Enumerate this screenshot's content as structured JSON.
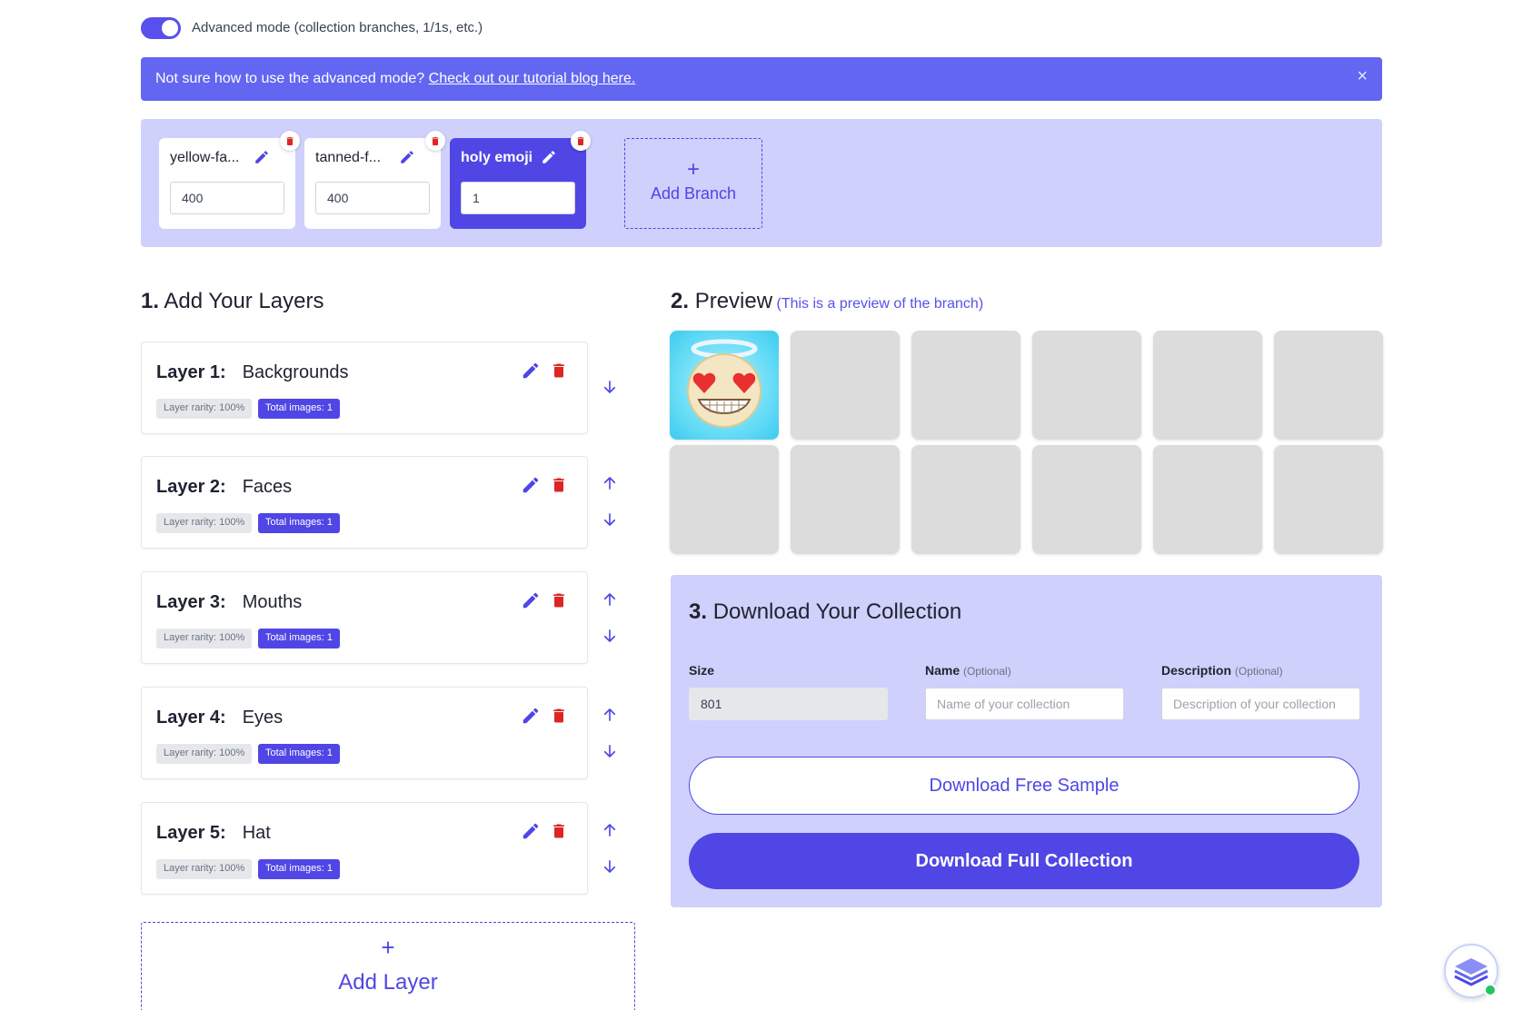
{
  "advanced_toggle": {
    "label": "Advanced mode (collection branches, 1/1s, etc.)",
    "on": true
  },
  "banner": {
    "text": "Not sure how to use the advanced mode?",
    "link": "Check out our tutorial blog here.",
    "close": "×"
  },
  "branches": {
    "items": [
      {
        "name": "yellow-fa...",
        "value": "400",
        "active": false
      },
      {
        "name": "tanned-f...",
        "value": "400",
        "active": false
      },
      {
        "name": "holy emoji",
        "value": "1",
        "active": true
      }
    ],
    "add_plus": "+",
    "add_label": "Add Branch"
  },
  "layers_section": {
    "num": "1.",
    "title": "Add Your Layers"
  },
  "layers": [
    {
      "num": "Layer 1:",
      "name": "Backgrounds",
      "rarity": "Layer rarity: 100%",
      "total": "Total images: 1"
    },
    {
      "num": "Layer 2:",
      "name": "Faces",
      "rarity": "Layer rarity: 100%",
      "total": "Total images: 1"
    },
    {
      "num": "Layer 3:",
      "name": "Mouths",
      "rarity": "Layer rarity: 100%",
      "total": "Total images: 1"
    },
    {
      "num": "Layer 4:",
      "name": "Eyes",
      "rarity": "Layer rarity: 100%",
      "total": "Total images: 1"
    },
    {
      "num": "Layer 5:",
      "name": "Hat",
      "rarity": "Layer rarity: 100%",
      "total": "Total images: 1"
    }
  ],
  "add_layer": {
    "plus": "+",
    "label": "Add Layer"
  },
  "preview_section": {
    "num": "2.",
    "title": "Preview",
    "subtitle": "(This is a preview of the branch)"
  },
  "download": {
    "num": "3.",
    "title": "Download Your Collection",
    "size_label": "Size",
    "size_value": "801",
    "name_label": "Name",
    "name_optional": "(Optional)",
    "name_placeholder": "Name of your collection",
    "desc_label": "Description",
    "desc_optional": "(Optional)",
    "desc_placeholder": "Description of your collection",
    "sample_button": "Download Free Sample",
    "full_button": "Download Full Collection"
  },
  "colors": {
    "accent": "#4f46e5",
    "panel": "#cfd0fb",
    "banner": "#6366f1",
    "danger": "#dc2626"
  }
}
